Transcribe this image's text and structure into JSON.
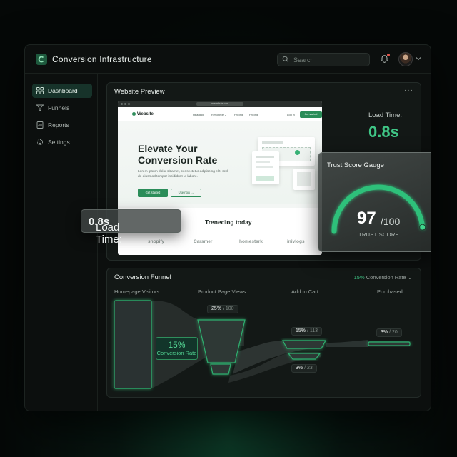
{
  "app": {
    "title": "Conversion Infrastructure"
  },
  "header": {
    "search_placeholder": "Search"
  },
  "sidebar": {
    "items": [
      {
        "label": "Dashboard",
        "icon": "grid-icon",
        "active": true
      },
      {
        "label": "Funnels",
        "icon": "funnel-icon",
        "active": false
      },
      {
        "label": "Reports",
        "icon": "report-icon",
        "active": false
      },
      {
        "label": "Settings",
        "icon": "gear-icon",
        "active": false
      }
    ]
  },
  "preview": {
    "title": "Website Preview",
    "menu": "···",
    "browser_url": "mywebsite.com",
    "site": {
      "logo": "Website",
      "nav": [
        "Heading",
        "Resource ⌄",
        "Pricing",
        "Pricing"
      ],
      "login": "Log in",
      "cta": "Get started",
      "headline": "Elevate Your Conversion Rate",
      "body": "Lorem ipsum dolor sit amet, consectetur adipiscing elit, sed do eiusmod tempor incididunt ut labore.",
      "primary_button": "Get started",
      "secondary_button": "Use now →",
      "trend_title": "Treneding today",
      "brands": [
        "shopify",
        "Carsmer",
        "homestark",
        "inivlogs"
      ]
    },
    "load_time_label": "Load Time:",
    "load_time_value": "0.8s"
  },
  "floating_load": {
    "label": "Load Time:",
    "value": "0.8s"
  },
  "trust": {
    "title": "Trust Score Gauge",
    "value": "97",
    "max": "/100",
    "label": "TRUST SCORE",
    "score": 97
  },
  "funnel": {
    "title": "Conversion Funnel",
    "selector_value": "15%",
    "selector_label": "Conversion Rate",
    "stages": [
      "Homepage Visitors",
      "Product Page Views",
      "Add to Cart",
      "Purchased"
    ],
    "badges": [
      {
        "pct": "25%",
        "rest": " / 100"
      },
      {
        "pct": "15%",
        "rest": " / 113"
      },
      {
        "pct": "3%",
        "rest": " / 23"
      },
      {
        "pct": "3%",
        "rest": " / 20"
      }
    ],
    "overall_value": "15%",
    "overall_label": "Conversion Rate"
  },
  "colors": {
    "accent": "#3fc585",
    "accent_dark": "#2b8d59",
    "panel": "#131816",
    "background": "#050807"
  }
}
